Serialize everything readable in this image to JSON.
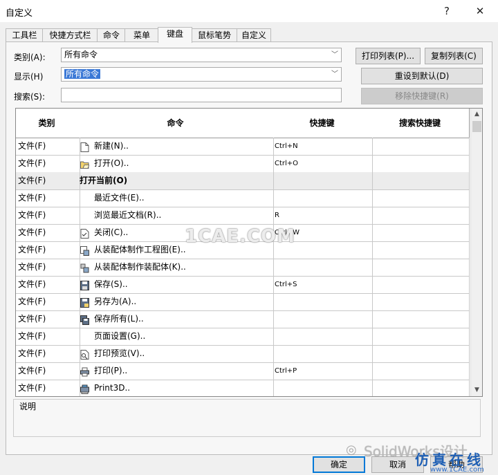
{
  "window": {
    "title": "自定义",
    "help_icon": "?",
    "close_icon": "✕"
  },
  "tabs": [
    {
      "label": "工具栏"
    },
    {
      "label": "快捷方式栏"
    },
    {
      "label": "命令"
    },
    {
      "label": "菜单"
    },
    {
      "label": "键盘",
      "active": true
    },
    {
      "label": "鼠标笔势"
    },
    {
      "label": "自定义"
    }
  ],
  "filters": {
    "category_label": "类别(A):",
    "category_value": "所有命令",
    "display_label": "显示(H)",
    "display_value": "所有命令",
    "search_label": "搜索(S):",
    "search_value": ""
  },
  "buttons": {
    "print_list": "打印列表(P)...",
    "copy_list": "复制列表(C)",
    "reset_default": "重设到默认(D)",
    "remove_shortcut": "移除快捷键(R)",
    "ok": "确定",
    "cancel": "取消",
    "help": "帮助"
  },
  "table": {
    "headers": {
      "category": "类别",
      "command": "命令",
      "shortcut": "快捷键",
      "search_shortcut": "搜索快捷键"
    },
    "rows": [
      {
        "category": "文件(F)",
        "command": "新建(N)..",
        "shortcut": "Ctrl+N",
        "icon": "new-document-icon"
      },
      {
        "category": "文件(F)",
        "command": "打开(O)..",
        "shortcut": "Ctrl+O",
        "icon": "open-folder-icon"
      },
      {
        "category": "文件(F)",
        "command": "打开当前(O)",
        "shortcut": "",
        "icon": "",
        "group": true
      },
      {
        "category": "文件(F)",
        "command": "最近文件(E)..",
        "shortcut": "",
        "icon": ""
      },
      {
        "category": "文件(F)",
        "command": "浏览最近文档(R)..",
        "shortcut": "R",
        "icon": ""
      },
      {
        "category": "文件(F)",
        "command": "关闭(C)..",
        "shortcut": "Ctrl+W",
        "icon": "close-document-icon"
      },
      {
        "category": "文件(F)",
        "command": "从装配体制作工程图(E)..",
        "shortcut": "",
        "icon": "make-drawing-icon"
      },
      {
        "category": "文件(F)",
        "command": "从装配体制作装配体(K)..",
        "shortcut": "",
        "icon": "make-assembly-icon"
      },
      {
        "category": "文件(F)",
        "command": "保存(S)..",
        "shortcut": "Ctrl+S",
        "icon": "save-icon"
      },
      {
        "category": "文件(F)",
        "command": "另存为(A)..",
        "shortcut": "",
        "icon": "save-as-icon"
      },
      {
        "category": "文件(F)",
        "command": "保存所有(L)..",
        "shortcut": "",
        "icon": "save-all-icon"
      },
      {
        "category": "文件(F)",
        "command": "页面设置(G)..",
        "shortcut": "",
        "icon": ""
      },
      {
        "category": "文件(F)",
        "command": "打印预览(V)..",
        "shortcut": "",
        "icon": "print-preview-icon"
      },
      {
        "category": "文件(F)",
        "command": "打印(P)..",
        "shortcut": "Ctrl+P",
        "icon": "print-icon"
      },
      {
        "category": "文件(F)",
        "command": "Print3D..",
        "shortcut": "",
        "icon": "print3d-icon"
      }
    ]
  },
  "description": {
    "label": "说明"
  },
  "watermarks": {
    "center": "1CAE.COM",
    "wechat": "SolidWorks设计",
    "site_cn": "仿真在线",
    "site_url": "www.1CAE.com"
  },
  "colors": {
    "selection": "#3a78d6",
    "default_button_border": "#0078d7",
    "site_text": "#1e5fb4"
  }
}
